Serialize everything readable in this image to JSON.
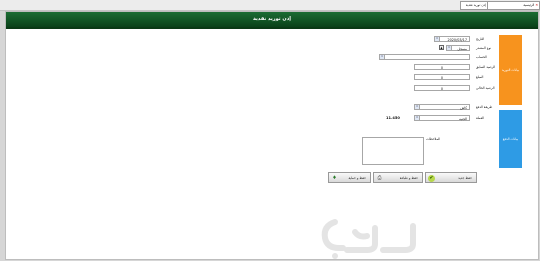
{
  "tabs": [
    {
      "label": "الرئيسية"
    },
    {
      "label": "إذن توريد نقدية"
    }
  ],
  "window": {
    "title": "إذن توريد نقدية"
  },
  "sections": {
    "first": "بيانات التوريد",
    "second": "بيانات الدفع"
  },
  "form": {
    "date_label": "التاريخ",
    "date_value": "2020/03/17",
    "date_icon": "calendar-icon",
    "payer_type_label": "نوع المصدر",
    "payer_type_value": "مسجل",
    "account_label": "الحساب",
    "account_value": "",
    "previous_balance_label": "الرصيد السابق",
    "previous_balance_value": "0",
    "amount_label": "المبلغ",
    "amount_value": "0",
    "current_balance_label": "الرصيد الحالي",
    "current_balance_value": "0",
    "payment_type_label": "طريقة الدفع",
    "payment_type_value": "كاش",
    "currency_label": "العملة",
    "currency_value": "الجنيه",
    "exchange_rate_value": "11.450",
    "notes_label": "الملاحظات",
    "notes_value": ""
  },
  "buttons": {
    "new": "حفظ جديد",
    "save_print": "حفظ و طباعة",
    "save_close": "حفظ و حماية"
  },
  "watermark": {
    "text": "حراج"
  },
  "colors": {
    "title_green": "#0f5223",
    "section_orange": "#f7931e",
    "section_blue": "#2e9be5"
  }
}
